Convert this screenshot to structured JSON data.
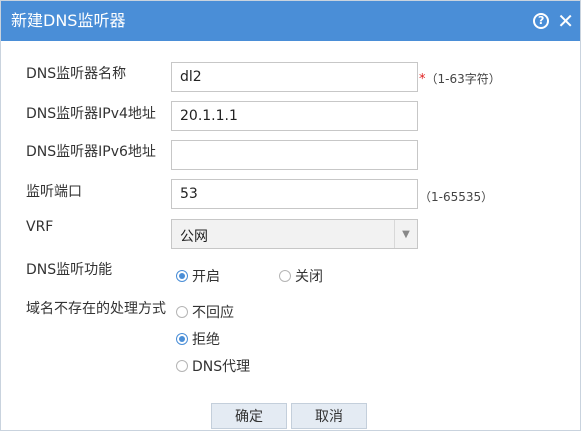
{
  "dialog": {
    "title": "新建DNS监听器",
    "help_icon": "question-circle-icon",
    "close_icon": "close-icon"
  },
  "form": {
    "name": {
      "label": "DNS监听器名称",
      "value": "dl2",
      "required_mark": "*",
      "hint": "（1-63字符）"
    },
    "ipv4": {
      "label": "DNS监听器IPv4地址",
      "value": "20.1.1.1"
    },
    "ipv6": {
      "label": "DNS监听器IPv6地址",
      "value": ""
    },
    "port": {
      "label": "监听端口",
      "value": "53",
      "hint": "（1-65535）"
    },
    "vrf": {
      "label": "VRF",
      "selected": "公网",
      "arrow_icon": "triangle-down-icon"
    },
    "listen": {
      "label": "DNS监听功能",
      "options": [
        {
          "label": "开启",
          "checked": true
        },
        {
          "label": "关闭",
          "checked": false
        }
      ]
    },
    "nx_handling": {
      "label": "域名不存在的处理方式",
      "options": [
        {
          "label": "不回应",
          "checked": false
        },
        {
          "label": "拒绝",
          "checked": true
        },
        {
          "label": "DNS代理",
          "checked": false
        }
      ]
    }
  },
  "buttons": {
    "ok": "确定",
    "cancel": "取消"
  },
  "colors": {
    "titlebar": "#4a8ed7",
    "required": "#e02020",
    "button_bg": "#e4ebf3"
  }
}
